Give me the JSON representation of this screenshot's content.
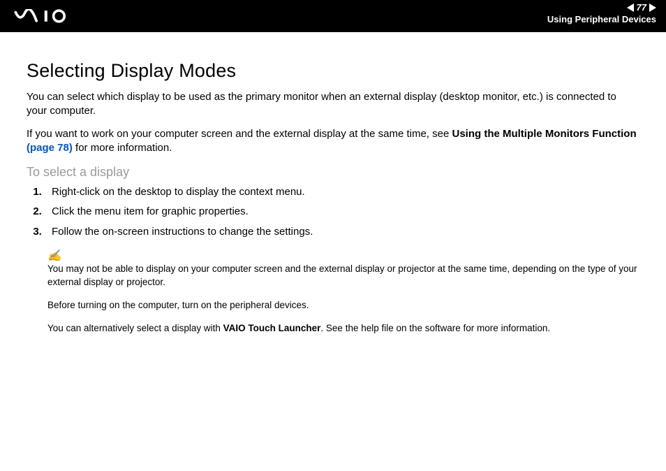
{
  "header": {
    "page_number": "77",
    "section": "Using Peripheral Devices"
  },
  "title": "Selecting Display Modes",
  "intro1": "You can select which display to be used as the primary monitor when an external display (desktop monitor, etc.) is connected to your computer.",
  "intro2_a": "If you want to work on your computer screen and the external display at the same time, see ",
  "intro2_bold": "Using the Multiple Monitors Function",
  "intro2_link": " (page 78)",
  "intro2_b": " for more information.",
  "subhead": "To select a display",
  "steps": [
    "Right-click on the desktop to display the context menu.",
    "Click the menu item for graphic properties.",
    "Follow the on-screen instructions to change the settings."
  ],
  "note_icon": "✍",
  "note1": "You may not be able to display on your computer screen and the external display or projector at the same time, depending on the type of your external display or projector.",
  "note2": "Before turning on the computer, turn on the peripheral devices.",
  "note3_a": "You can alternatively select a display with ",
  "note3_bold": "VAIO Touch Launcher",
  "note3_b": ". See the help file on the software for more information."
}
